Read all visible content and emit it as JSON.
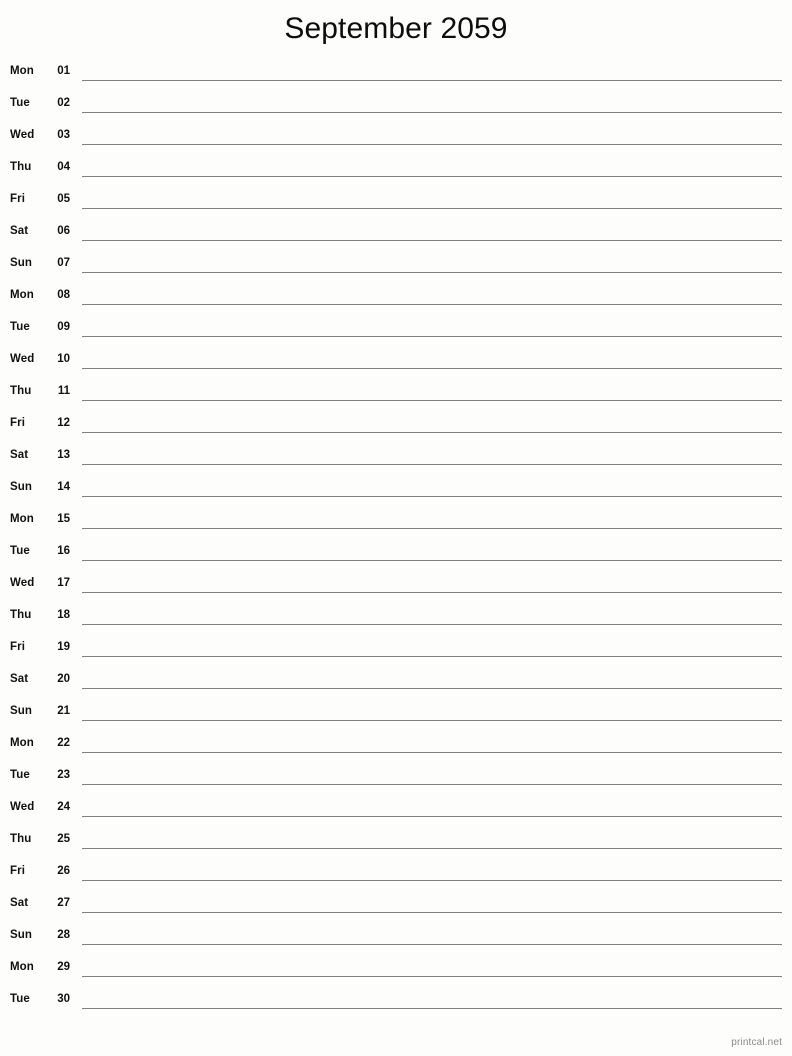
{
  "document": {
    "type": "printable-monthly-calendar",
    "title": "September 2059",
    "month": "September",
    "year": "2059",
    "footer_credit": "printcal.net"
  },
  "colors": {
    "background": "#fdfdfb",
    "text": "#111111",
    "rule_line": "#7f817c",
    "footer_text": "#8a8a8a"
  },
  "days": [
    {
      "dow": "Mon",
      "num": "01",
      "note": ""
    },
    {
      "dow": "Tue",
      "num": "02",
      "note": ""
    },
    {
      "dow": "Wed",
      "num": "03",
      "note": ""
    },
    {
      "dow": "Thu",
      "num": "04",
      "note": ""
    },
    {
      "dow": "Fri",
      "num": "05",
      "note": ""
    },
    {
      "dow": "Sat",
      "num": "06",
      "note": ""
    },
    {
      "dow": "Sun",
      "num": "07",
      "note": ""
    },
    {
      "dow": "Mon",
      "num": "08",
      "note": ""
    },
    {
      "dow": "Tue",
      "num": "09",
      "note": ""
    },
    {
      "dow": "Wed",
      "num": "10",
      "note": ""
    },
    {
      "dow": "Thu",
      "num": "11",
      "note": ""
    },
    {
      "dow": "Fri",
      "num": "12",
      "note": ""
    },
    {
      "dow": "Sat",
      "num": "13",
      "note": ""
    },
    {
      "dow": "Sun",
      "num": "14",
      "note": ""
    },
    {
      "dow": "Mon",
      "num": "15",
      "note": ""
    },
    {
      "dow": "Tue",
      "num": "16",
      "note": ""
    },
    {
      "dow": "Wed",
      "num": "17",
      "note": ""
    },
    {
      "dow": "Thu",
      "num": "18",
      "note": ""
    },
    {
      "dow": "Fri",
      "num": "19",
      "note": ""
    },
    {
      "dow": "Sat",
      "num": "20",
      "note": ""
    },
    {
      "dow": "Sun",
      "num": "21",
      "note": ""
    },
    {
      "dow": "Mon",
      "num": "22",
      "note": ""
    },
    {
      "dow": "Tue",
      "num": "23",
      "note": ""
    },
    {
      "dow": "Wed",
      "num": "24",
      "note": ""
    },
    {
      "dow": "Thu",
      "num": "25",
      "note": ""
    },
    {
      "dow": "Fri",
      "num": "26",
      "note": ""
    },
    {
      "dow": "Sat",
      "num": "27",
      "note": ""
    },
    {
      "dow": "Sun",
      "num": "28",
      "note": ""
    },
    {
      "dow": "Mon",
      "num": "29",
      "note": ""
    },
    {
      "dow": "Tue",
      "num": "30",
      "note": ""
    }
  ]
}
